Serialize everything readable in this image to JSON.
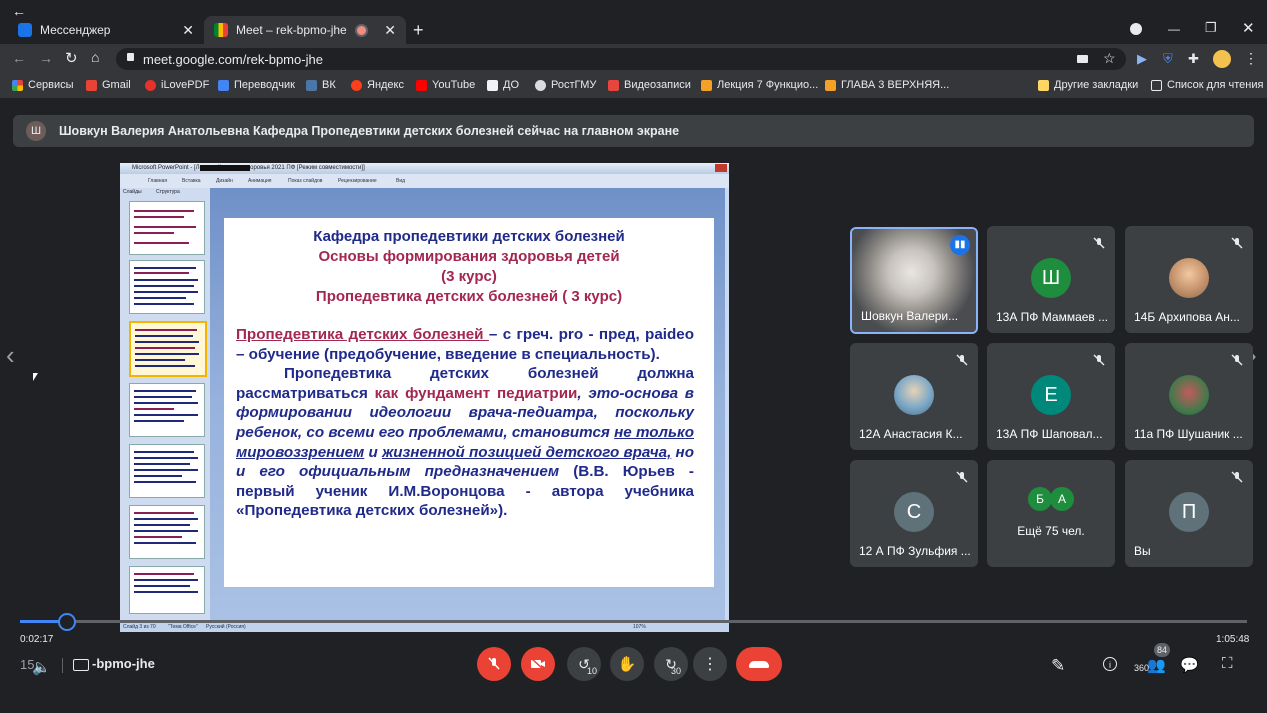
{
  "browser": {
    "tabs": [
      {
        "title": "Мессенджер",
        "active": false
      },
      {
        "title": "Meet – rek-bpmo-jhe",
        "active": true
      }
    ],
    "url": "meet.google.com/rek-bpmo-jhe",
    "bookmarks": [
      {
        "label": "Сервисы",
        "icon": "apps-grid-icon"
      },
      {
        "label": "Gmail",
        "icon": "gmail-icon"
      },
      {
        "label": "iLovePDF",
        "icon": "heart-icon"
      },
      {
        "label": "Переводчик",
        "icon": "translate-icon"
      },
      {
        "label": "ВК",
        "icon": "vk-icon"
      },
      {
        "label": "Яндекс",
        "icon": "yandex-icon"
      },
      {
        "label": "YouTube",
        "icon": "youtube-icon"
      },
      {
        "label": "ДО",
        "icon": "shield-icon"
      },
      {
        "label": "РостГМУ",
        "icon": "university-icon"
      },
      {
        "label": "Видеозаписи",
        "icon": "video-icon"
      },
      {
        "label": "Лекция 7 Функцио...",
        "icon": "document-icon"
      },
      {
        "label": "ГЛАВА 3 ВЕРХНЯЯ...",
        "icon": "plus-icon"
      }
    ],
    "other_bookmarks": "Другие закладки",
    "reading_list": "Список для чтения"
  },
  "meet": {
    "banner_avatar": "Ш",
    "banner_text": "Шовкун Валерия Анатольевна Кафедра Пропедевтики детских болезней сейчас на главном экране",
    "presentation": {
      "window_title": "Microsoft PowerPoint - [Лекции Культура здоровья 2021 ПФ [Режим совместимости]]",
      "ribbon": [
        "Главная",
        "Вставка",
        "Дизайн",
        "Анимация",
        "Показ слайдов",
        "Рецензирование",
        "Вид"
      ],
      "side_tabs": [
        "Слайды",
        "Структура"
      ],
      "status": [
        "Слайд 3 из 70",
        "\"Тема Office\"",
        "Русский (Россия)"
      ],
      "zoom": "107%",
      "slide": {
        "h1": "Кафедра пропедевтики детских болезней",
        "h2": "Основы формирования здоровья детей",
        "h3": "(3 курс)",
        "h4": "Пропедевтика детских болезней ( 3 курс)",
        "p1_underlined": "Пропедевтика детских болезней ",
        "p1_rest": "– с греч. pro - пред, paideo – обучение (предобучение, введение в специальность).",
        "p2_a": "Пропедевтика детских болезней должна рассматриваться",
        "p2_b": "как фундамент педиатрии",
        "p2_c": ", это-основа в формировании идеологии врача-педиатра, поскольку ребенок, со всеми его проблемами, становится ",
        "p2_d": "не только мировоззрением",
        "p2_e": " и ",
        "p2_f": "жизненной позицией детского врача,",
        "p2_g": " но и его официальным предназначением",
        "p2_h": " (В.В. Юрьев - первый ученик И.М.Воронцова - автора учебника «Пропедевтика детских болезней»)."
      }
    },
    "participants": [
      {
        "name": "Шовкун Валери...",
        "initial": "",
        "color": "#8a8f94",
        "muted": false,
        "speaking": true
      },
      {
        "name": "13А ПФ Маммаев ...",
        "initial": "Ш",
        "color": "#1e8e3e",
        "muted": true
      },
      {
        "name": "14Б Архипова Ан...",
        "initial": "",
        "color": "#c9966f",
        "muted": true
      },
      {
        "name": "12А Анастасия К...",
        "initial": "",
        "color": "#7aa7c7",
        "muted": true
      },
      {
        "name": "13А ПФ Шаповал...",
        "initial": "Е",
        "color": "#00897b",
        "muted": true
      },
      {
        "name": "11а ПФ Шушаник ...",
        "initial": "",
        "color": "#c25b5b",
        "muted": true
      },
      {
        "name": "12 А ПФ Зульфия ...",
        "initial": "С",
        "color": "#5f7179",
        "muted": true
      },
      {
        "name": "Ещё 75 чел.",
        "initials": [
          "Б",
          "А"
        ],
        "color": "#1e8e3e",
        "muted": false
      },
      {
        "name": "Вы",
        "initial": "П",
        "color": "#5f7179",
        "muted": true
      }
    ],
    "player": {
      "elapsed": "0:02:17",
      "duration": "1:05:48",
      "progress_fraction": 0.038,
      "meeting_code": "-bpmo-jhe",
      "time_prefix": "15",
      "rewind_label": "10",
      "forward_label": "30",
      "people_count": "84",
      "vr_label": "360"
    },
    "colors": {
      "end_call": "#ea4335",
      "muted_button": "#ea4335",
      "accent": "#4285f4"
    }
  }
}
